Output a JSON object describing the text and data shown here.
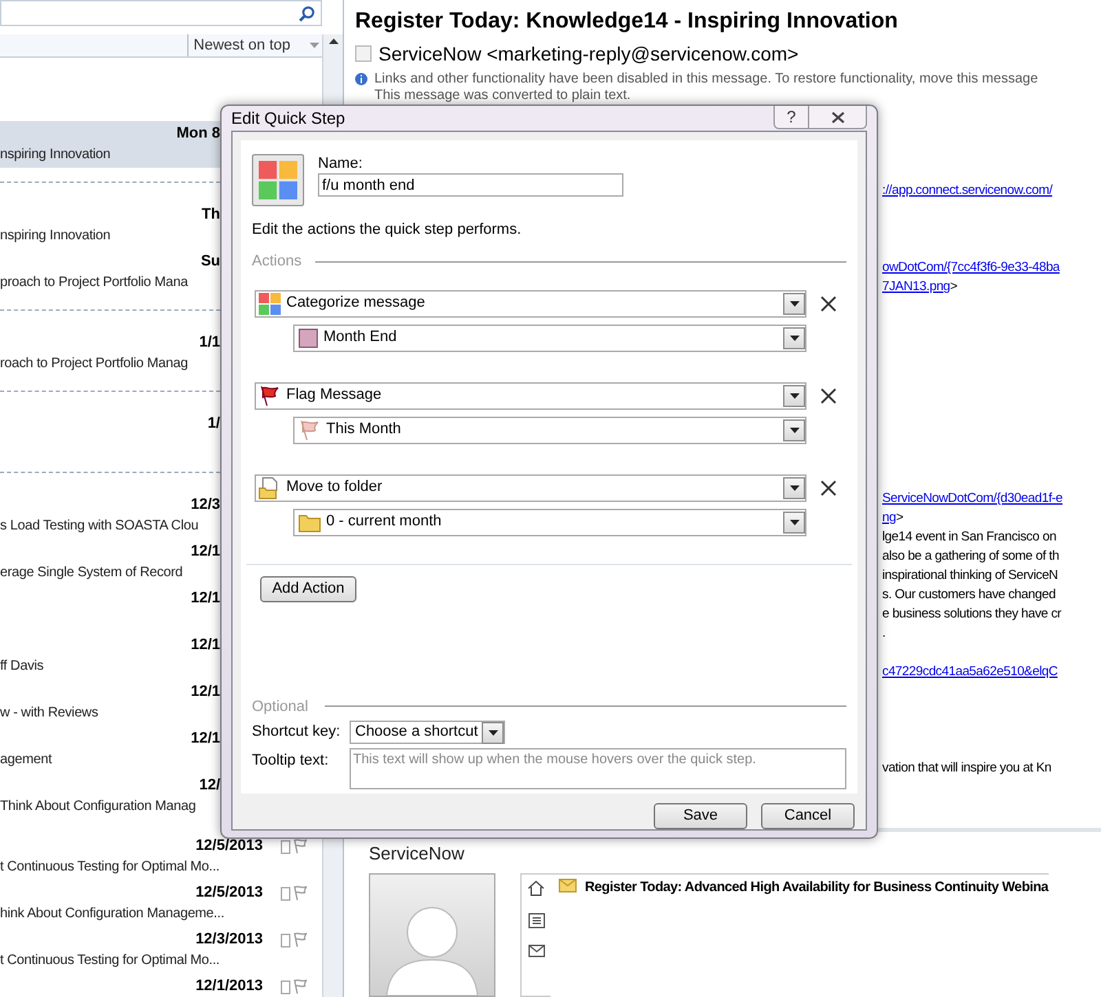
{
  "message_list": {
    "sort_label": "Newest on top",
    "groups_beside_dialog": [
      {
        "rows": [
          {
            "date": "Mon 8",
            "subject": "nspiring Innovation",
            "selected": true
          }
        ]
      },
      {
        "rows": [
          {
            "date": "Th",
            "subject": "nspiring Innovation",
            "selected": false
          },
          {
            "date": "Su",
            "subject": "proach to Project Portfolio Mana",
            "selected": false
          }
        ]
      },
      {
        "rows": [
          {
            "date": "1/1",
            "subject": "roach to Project Portfolio Manag",
            "selected": false
          }
        ]
      },
      {
        "rows": [
          {
            "date": "1/",
            "selected": false
          }
        ]
      },
      {
        "rows": [
          {
            "date": "12/3",
            "subject": "s Load Testing with SOASTA Clou",
            "selected": false
          },
          {
            "date": "12/1",
            "subject": "erage Single System of Record",
            "selected": false
          },
          {
            "date": "12/1",
            "selected": false
          },
          {
            "date": "12/1",
            "subject": "ff Davis",
            "selected": false
          },
          {
            "date": "12/1",
            "subject": "w - with Reviews",
            "selected": false
          },
          {
            "date": "12/1",
            "subject": "agement",
            "selected": false
          },
          {
            "date": "12/",
            "subject": "Think About Configuration Manag",
            "selected": false
          }
        ]
      }
    ],
    "rows": [
      {
        "date": "12/5/2013",
        "subject": "t Continuous Testing for Optimal Mo...",
        "selected": false
      },
      {
        "date": "12/5/2013",
        "subject": "hink About Configuration Manageme...",
        "selected": false
      },
      {
        "date": "12/3/2013",
        "subject": "t Continuous Testing for Optimal Mo...",
        "selected": false
      },
      {
        "date": "12/1/2013",
        "selected": false
      }
    ]
  },
  "reading_pane": {
    "subject": "Register Today: Knowledge14 - Inspiring Innovation",
    "sender": "ServiceNow <marketing-reply@servicenow.com>",
    "sender_checked": false,
    "info": "Links and other functionality have been disabled in this message. To restore functionality, move this message",
    "info_2": "This message was converted to plain text.",
    "body_lines": [
      {
        "kind": "line",
        "parts": [
          {
            "text": "://app.connect.servicenow.com/",
            "link": true
          }
        ]
      },
      {
        "kind": "blank"
      },
      {
        "kind": "blank"
      },
      {
        "kind": "blank"
      },
      {
        "kind": "line",
        "parts": [
          {
            "text": "owDotCom/{7cc4f3f6-9e33-48ba",
            "link": true
          }
        ]
      },
      {
        "kind": "line",
        "parts": [
          {
            "text": "7JAN13.png",
            "link": true
          },
          {
            "text": ">",
            "link": false
          }
        ]
      },
      {
        "kind": "blank"
      },
      {
        "kind": "blank"
      },
      {
        "kind": "blank"
      },
      {
        "kind": "blank"
      },
      {
        "kind": "blank"
      },
      {
        "kind": "blank"
      },
      {
        "kind": "blank"
      },
      {
        "kind": "blank"
      },
      {
        "kind": "blank"
      },
      {
        "kind": "blank"
      },
      {
        "kind": "line",
        "parts": [
          {
            "text": "ServiceNowDotCom/{d30ead1f-e",
            "link": true
          }
        ]
      },
      {
        "kind": "line",
        "parts": [
          {
            "text": "ng",
            "link": true
          },
          {
            "text": ">",
            "link": false
          }
        ]
      },
      {
        "kind": "line",
        "parts": [
          {
            "text": "lge14 event in San Francisco on",
            "link": false
          }
        ]
      },
      {
        "kind": "line",
        "parts": [
          {
            "text": "also be a gathering of some of th",
            "link": false
          }
        ]
      },
      {
        "kind": "line",
        "parts": [
          {
            "text": "inspirational thinking of ServiceN",
            "link": false
          }
        ]
      },
      {
        "kind": "line",
        "parts": [
          {
            "text": "s.  Our customers have changed",
            "link": false
          }
        ]
      },
      {
        "kind": "line",
        "parts": [
          {
            "text": "e business solutions they have cr",
            "link": false
          }
        ]
      },
      {
        "kind": "line",
        "parts": [
          {
            "text": ".",
            "link": false
          }
        ]
      },
      {
        "kind": "blank"
      },
      {
        "kind": "line",
        "parts": [
          {
            "text": "c47229cdc41aa5a62e510&elqC",
            "link": true
          }
        ]
      },
      {
        "kind": "blank"
      },
      {
        "kind": "blank"
      },
      {
        "kind": "blank"
      },
      {
        "kind": "blank"
      },
      {
        "kind": "line",
        "parts": [
          {
            "text": "vation that will inspire you at Kn",
            "link": false
          }
        ]
      }
    ]
  },
  "people_pane": {
    "name": "ServiceNow",
    "item": "Register Today: Advanced High Availability for Business Continuity Webina"
  },
  "dialog": {
    "title": "Edit Quick Step",
    "help": "?",
    "name_label": "Name:",
    "name_value": "f/u month end",
    "description": "Edit the actions the quick step performs.",
    "actions_label": "Actions",
    "actions": [
      {
        "kind": "categorize",
        "label": "Categorize message",
        "option": {
          "kind": "category",
          "label": "Month End",
          "color": "#d4a5bd"
        }
      },
      {
        "kind": "flag",
        "label": "Flag Message",
        "option": {
          "kind": "flag",
          "label": "This Month"
        }
      },
      {
        "kind": "move",
        "label": "Move to folder",
        "option": {
          "kind": "folder",
          "label": "0 - current month"
        }
      }
    ],
    "add_action": "Add Action",
    "optional_label": "Optional",
    "shortcut_label": "Shortcut key:",
    "shortcut_value": "Choose a shortcut",
    "tooltip_label": "Tooltip text:",
    "tooltip_placeholder": "This text will show up when the mouse hovers over the quick step.",
    "buttons": [
      "Save",
      "Cancel"
    ]
  }
}
